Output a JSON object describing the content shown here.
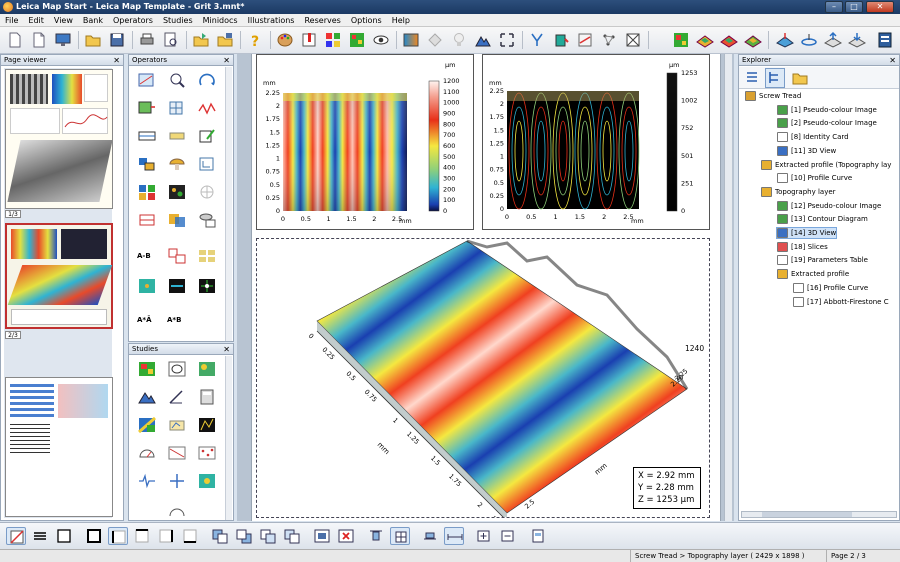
{
  "window": {
    "title": "Leica Map Start - Leica Map Template - Grit 3.mnt*"
  },
  "menu": [
    "File",
    "Edit",
    "View",
    "Bank",
    "Operators",
    "Studies",
    "Minidocs",
    "Illustrations",
    "Reserves",
    "Options",
    "Help"
  ],
  "panels": {
    "page_viewer": "Page viewer",
    "operators": "Operators",
    "studies": "Studies",
    "explorer": "Explorer"
  },
  "page_viewer": {
    "labels": [
      "1/3",
      "2/3"
    ]
  },
  "operator_labels": [
    "A-B",
    "A*Ā",
    "A*B"
  ],
  "chart_data": [
    {
      "type": "heatmap",
      "ylabel": "mm",
      "xlabel": "mm",
      "unit": "µm",
      "y_ticks": [
        "2.25",
        "2",
        "1.75",
        "1.5",
        "1.25",
        "1",
        "0.75",
        "0.5",
        "0.25",
        "0"
      ],
      "x_ticks": [
        "0",
        "0.5",
        "1",
        "1.5",
        "2",
        "2.5"
      ],
      "colorbar_ticks": [
        "1200",
        "1100",
        "1000",
        "900",
        "800",
        "700",
        "600",
        "500",
        "400",
        "300",
        "200",
        "100",
        "0"
      ]
    },
    {
      "type": "contour",
      "ylabel": "mm",
      "xlabel": "mm",
      "unit": "µm",
      "y_ticks": [
        "2.25",
        "2",
        "1.75",
        "1.5",
        "1.25",
        "1",
        "0.75",
        "0.5",
        "0.25",
        "0"
      ],
      "x_ticks": [
        "0",
        "0.5",
        "1",
        "1.5",
        "2",
        "2.5"
      ],
      "colorbar_ticks": [
        "1253",
        "1002",
        "752",
        "501",
        "251",
        "0"
      ]
    }
  ],
  "view3d": {
    "left_ticks": [
      "0",
      "0.25",
      "0.5",
      "0.75",
      "1",
      "1.25",
      "1.5",
      "1.75",
      "2",
      "2.25"
    ],
    "right_ticks": [
      "2.5",
      "2.25",
      "2.20"
    ],
    "z_top": "1240",
    "axis_unit": "mm",
    "readout": {
      "x": "X = 2.92 mm",
      "y": "Y = 2.28 mm",
      "z": "Z = 1253 µm"
    }
  },
  "explorer": {
    "items": [
      {
        "label": "Screw Tread",
        "level": 0
      },
      {
        "label": "[1] Pseudo-colour Image",
        "level": 2
      },
      {
        "label": "[2] Pseudo-colour Image",
        "level": 2
      },
      {
        "label": "[8] Identity Card",
        "level": 2
      },
      {
        "label": "[11] 3D View",
        "level": 2
      },
      {
        "label": "Extracted profile (Topography lay",
        "level": 1
      },
      {
        "label": "[10] Profile Curve",
        "level": 2
      },
      {
        "label": "Topography layer",
        "level": 1
      },
      {
        "label": "[12] Pseudo-colour Image",
        "level": 2
      },
      {
        "label": "[13] Contour Diagram",
        "level": 2
      },
      {
        "label": "[14] 3D View",
        "level": 2
      },
      {
        "label": "[18] Slices",
        "level": 2
      },
      {
        "label": "[19] Parameters Table",
        "level": 2
      },
      {
        "label": "Extracted profile",
        "level": 2
      },
      {
        "label": "[16] Profile Curve",
        "level": 3
      },
      {
        "label": "[17] Abbott-Firestone C",
        "level": 3
      }
    ]
  },
  "status": {
    "context": "Screw Tread > Topography layer ( 2429 x 1898 )",
    "page": "Page 2 / 3"
  },
  "colors": {
    "titlebar": "#1b3963",
    "selection": "#cfe2f8",
    "thumb_selected_border": "#c03030"
  }
}
